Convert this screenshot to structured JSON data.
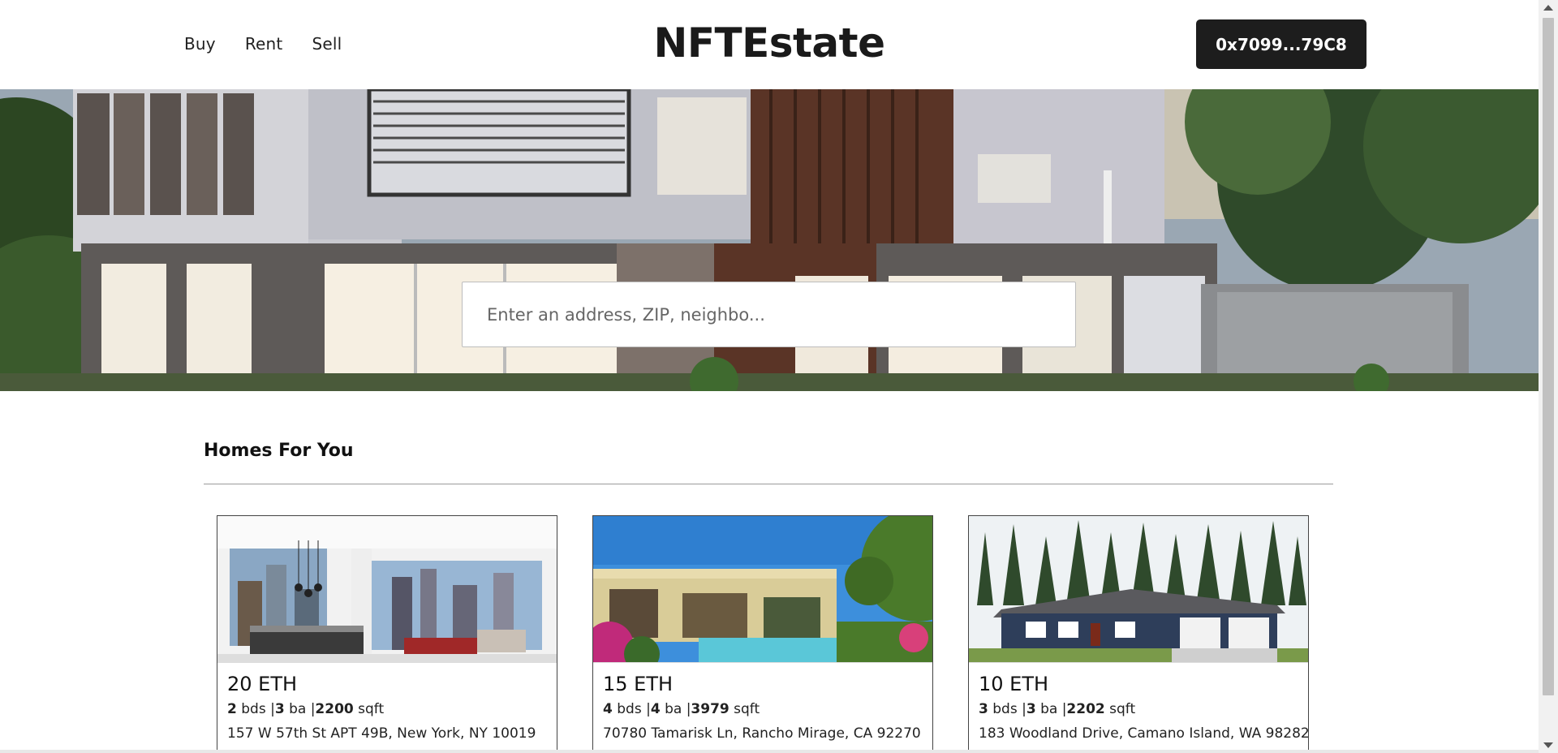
{
  "header": {
    "nav": [
      {
        "label": "Buy"
      },
      {
        "label": "Rent"
      },
      {
        "label": "Sell"
      }
    ],
    "brand": "NFTEstate",
    "wallet_label": "0x7099...79C8"
  },
  "hero": {
    "search_placeholder": "Enter an address, ZIP, neighbo..."
  },
  "homes": {
    "title": "Homes For You",
    "listings": [
      {
        "price": "20 ETH",
        "beds": "2",
        "beds_unit": " bds |",
        "baths": "3",
        "baths_unit": " ba |",
        "sqft": "2200",
        "sqft_unit": " sqft",
        "address": "157 W 57th St APT 49B, New York, NY 10019"
      },
      {
        "price": "15 ETH",
        "beds": "4",
        "beds_unit": " bds |",
        "baths": "4",
        "baths_unit": " ba |",
        "sqft": "3979",
        "sqft_unit": " sqft",
        "address": "70780 Tamarisk Ln, Rancho Mirage, CA 92270"
      },
      {
        "price": "10 ETH",
        "beds": "3",
        "beds_unit": " bds |",
        "baths": "3",
        "baths_unit": " ba |",
        "sqft": "2202",
        "sqft_unit": " sqft",
        "address": "183 Woodland Drive, Camano Island, WA 98282"
      }
    ]
  },
  "colors": {
    "wallet_button_bg": "#1d1d1d",
    "text": "#111111",
    "divider": "#9a9a9a"
  }
}
